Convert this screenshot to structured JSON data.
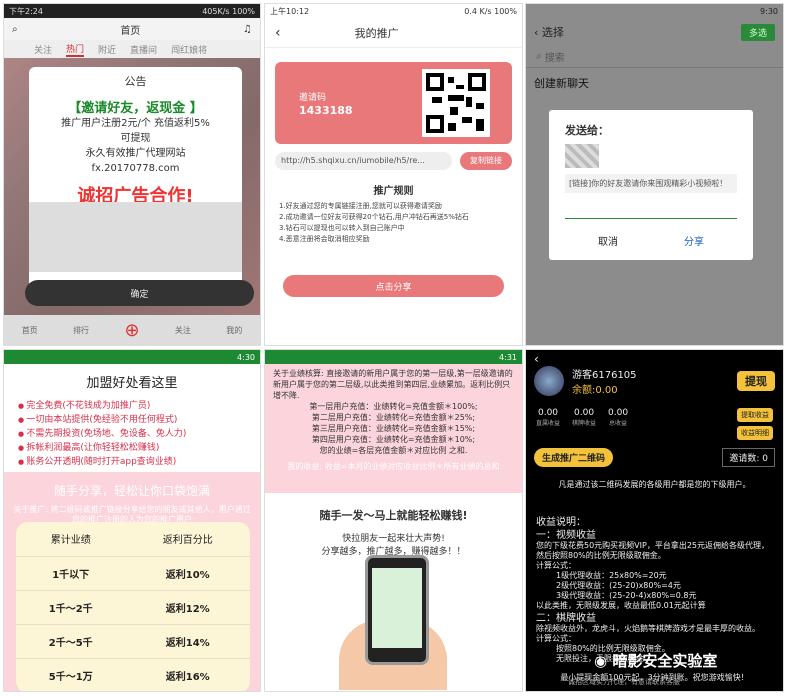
{
  "p1": {
    "time": "下午2:24",
    "net": "405K/s",
    "batt": "100%",
    "title": "首页",
    "tabs": [
      "关注",
      "热门",
      "附近",
      "直播间",
      "闯红娘将"
    ],
    "modal_title": "公告",
    "green": "【邀请好友，返现金 】",
    "l1": "推广用户注册2元/个  充值返利5%",
    "l2": "可提现",
    "l3": "永久有效推广代理网站",
    "l4": "fx.20170778.com",
    "red": "诚招广告合作!",
    "ok": "确定",
    "nav": [
      "首页",
      "排行",
      "",
      "关注",
      "我的"
    ]
  },
  "p2": {
    "time": "上午10:12",
    "net": "0.4 K/s",
    "batt": "100%",
    "title": "我的推广",
    "code_label": "邀请码",
    "code": "1433188",
    "url": "http://h5.shqixu.cn/iumobile/h5/re...",
    "copy": "复制链接",
    "rules_title": "推广规则",
    "rules": [
      "1.好友通过您的专属链接注册,您就可以获得邀请奖励",
      "2.成功邀请一位好友可获得20个钻石,用户冲钻石再送5%钻石",
      "3.钻石可以提现也可以转入到自己账户中",
      "4.恶意注册将会取消相应奖励"
    ],
    "share": "点击分享"
  },
  "p3": {
    "time": "9:30",
    "title": "选择",
    "multi": "多选",
    "search": "搜索",
    "newchat": "创建新聊天",
    "dlg_title": "发送给：",
    "msg": "[链接]你的好友邀请你来围观精彩小视频啦！",
    "cancel": "取消",
    "share": "分享"
  },
  "p4": {
    "time": "4:30",
    "title": "加盟好处看这里",
    "items": [
      "完全免费(不花钱成为加推广员)",
      "一切由本站提供(免经验不用任何程式)",
      "不需先期投资(免场地、免设备、免人力)",
      "拆帐利润最高(让你轻轻松松赚钱)",
      "账务公开透明(随时打开app查询业绩)"
    ],
    "pink_title": "随手分享，轻松让你口袋饱满",
    "pink_desc": "关于推广: 将二维码或推广链接分享给您的朋友或其他人，用户通过您的推广注册的人为您的推广用户",
    "th": [
      "累计业绩",
      "返利百分比"
    ],
    "rows": [
      [
        "1千以下",
        "返利10%"
      ],
      [
        "1千～2千",
        "返利12%"
      ],
      [
        "2千～5千",
        "返利14%"
      ],
      [
        "5千～1万",
        "返利16%"
      ]
    ]
  },
  "p5": {
    "time": "4:31",
    "top": "关于业绩核算: 直接邀请的新用户属于您的第一层级,第一层级邀请的新用户属于您的第二层级,以此类推到第四层,业绩累加。返利比例只增不降.",
    "lv": [
      "第一层用户充值：业绩转化=充值金额＊100%;",
      "第二层用户充值：业绩转化=充值金额＊25%;",
      "第三层用户充值：业绩转化=充值金额＊15%;",
      "第四层用户充值：业绩转化=充值金额＊10%;",
      "您的业绩=各层充值金额＊对应比例 之和."
    ],
    "fo": "我的收益: 收益=本月的业绩对应收益比例＊所有业绩的总和",
    "h": "随手一发～马上就能轻松赚钱!",
    "t1": "快拉朋友一起来壮大声势!",
    "t2": "分享越多，推广越多，赚得越多！！"
  },
  "p6": {
    "name": "游客6176105",
    "bal": "余额:0.00",
    "wd": "提现",
    "stats": [
      [
        "0.00",
        "直属收益"
      ],
      [
        "0.00",
        "棋牌收益"
      ],
      [
        "0.00",
        "总收益"
      ]
    ],
    "y1": "提取收益",
    "y2": "收益明细",
    "gen": "生成推广二维码",
    "inv": "邀请数: 0",
    "note": "凡是通过该二维码发展的各级用户都是您的下级用户。",
    "desc": "收益说明：",
    "s1": "一：视频收益",
    "s1a": "您的下级花费50元购买视频VIP，平台拿出25元返佣给各级代理，然后按照80%的比例无限级取佣金。",
    "s1b": "计算公式：",
    "s1c": [
      "1级代理收益：25x80%=20元",
      "2级代理收益：(25-20)x80%=4元",
      "3级代理收益：(25-20-4)x80%=0.8元"
    ],
    "s1d": "以此类推，无限级发展，收益最低0.01元起计算",
    "s2": "二：棋牌收益",
    "s2a": "除视频收益外，龙虎斗，火焰鹅等棋牌游戏才是最丰厚的收益。",
    "s2b": "计算公式：",
    "s2c": [
      "按照80%的比例无限级取佣金。",
      "无限投注，无限抽取佣金"
    ],
    "min": "最小提现金额100元起，3分钟到账。祝您游戏愉快！",
    "wm": "暗影安全实验室",
    "ft": "诚招区域实力代理，有意请联系客服"
  }
}
